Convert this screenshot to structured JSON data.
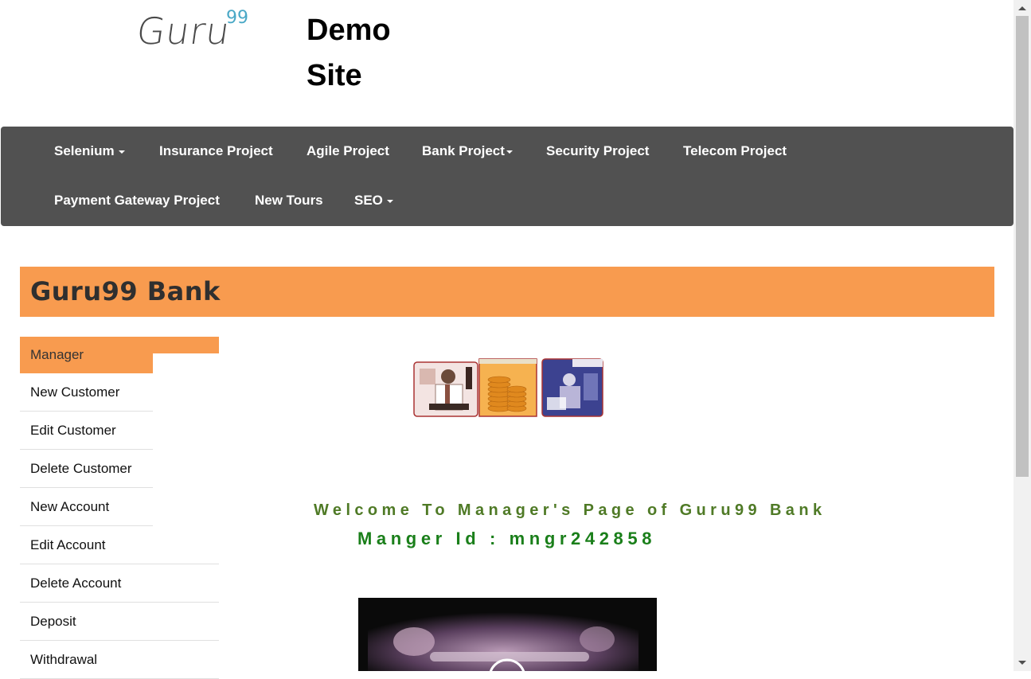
{
  "logo": {
    "text": "Guru",
    "superscript": "99"
  },
  "site_title": "Demo Site",
  "navbar": {
    "selenium": "Selenium",
    "insurance": "Insurance Project",
    "agile": "Agile Project",
    "bank": "Bank Project",
    "security": "Security Project",
    "telecom": "Telecom Project",
    "payment": "Payment Gateway Project",
    "new_tours": "New Tours",
    "seo": "SEO"
  },
  "banner": {
    "title": "Guru99 Bank"
  },
  "sidebar": {
    "header": "Manager",
    "items": [
      {
        "label": "New Customer"
      },
      {
        "label": "Edit Customer"
      },
      {
        "label": "Delete Customer"
      },
      {
        "label": "New Account"
      },
      {
        "label": "Edit Account"
      },
      {
        "label": "Delete Account"
      },
      {
        "label": "Deposit"
      },
      {
        "label": "Withdrawal"
      }
    ]
  },
  "main": {
    "welcome": "Welcome To Manager's Page of Guru99 Bank",
    "manager_id": "Manger Id : mngr242858"
  },
  "colors": {
    "navbar_bg": "#515151",
    "accent_orange": "#f89b4f",
    "welcome_green": "#4f7a26",
    "manager_id_green": "#1a7f1a",
    "logo_superscript": "#4aa8c6"
  }
}
